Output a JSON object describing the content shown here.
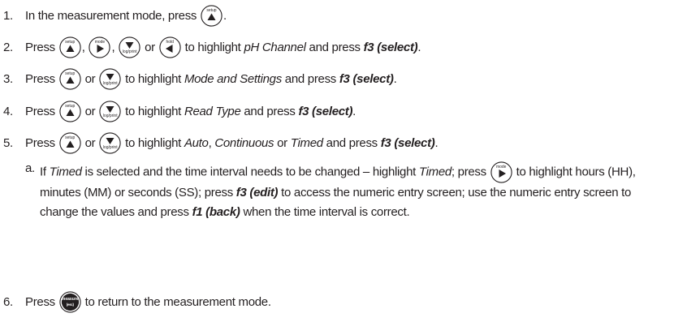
{
  "keys": {
    "setup": "setup",
    "mode": "mode",
    "log_print": "log/print",
    "hold": "hold",
    "measure": "measure",
    "esc": "(esc)"
  },
  "steps": [
    {
      "num": "1.",
      "text_a": "In the measurement mode, press",
      "text_b": "."
    },
    {
      "num": "2.",
      "text_a": "Press",
      "sep1": ",",
      "sep2": ",",
      "or": "or",
      "text_b": "to highlight",
      "emph": "pH Channel",
      "text_c": "and press",
      "bold": "f3 (select)",
      "end": "."
    },
    {
      "num": "3.",
      "text_a": "Press",
      "or": "or",
      "text_b": "to highlight",
      "emph": "Mode and Settings",
      "text_c": "and press",
      "bold": "f3 (select)",
      "end": "."
    },
    {
      "num": "4.",
      "text_a": "Press",
      "or": "or",
      "text_b": "to highlight",
      "emph": "Read Type",
      "text_c": "and press",
      "bold": "f3 (select)",
      "end": "."
    },
    {
      "num": "5.",
      "text_a": "Press",
      "or": "or",
      "text_b": "to highlight",
      "emph1": "Auto",
      "comma": ",",
      "emph2": "Continuous",
      "or2": "or",
      "emph3": "Timed",
      "text_c": "and press",
      "bold": "f3 (select)",
      "end": "."
    },
    {
      "num": "6.",
      "text_a": "Press",
      "text_b": "to return to the measurement mode."
    }
  ],
  "substep": {
    "letter": "a.",
    "t1": "If",
    "e1": "Timed",
    "t2": "is selected and the time interval needs to be changed – highlight",
    "e2": "Timed",
    "t3": "; press",
    "t4": "to highlight hours (HH), minutes (MM) or seconds (SS); press",
    "b1": "f3 (edit)",
    "t5": "to access the numeric entry screen; use the numeric entry screen to change the values and press",
    "b2": "f1 (back)",
    "t6": "when the time interval is correct."
  }
}
